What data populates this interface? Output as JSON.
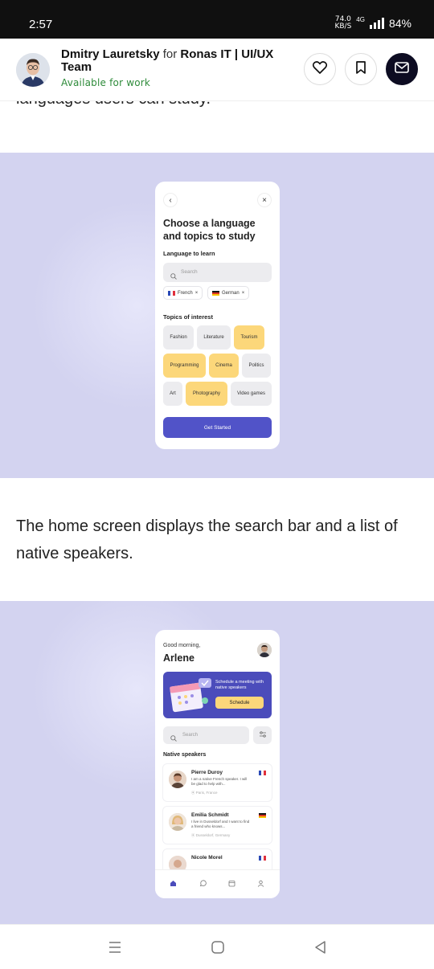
{
  "status_bar": {
    "time": "2:57",
    "speed_value": "74.0",
    "speed_unit": "KB/S",
    "network": "4G",
    "battery": "84%"
  },
  "header": {
    "author_name": "Dmitry Lauretsky",
    "for_text": "for",
    "team_name": "Ronas IT | UI/UX Team",
    "availability": "Available for work",
    "icons": [
      "heart-icon",
      "bookmark-icon",
      "mail-icon"
    ]
  },
  "article": {
    "cut_text": "languages users can study.",
    "paragraph": "The home screen displays the search bar and a list of native speakers."
  },
  "screen1": {
    "back": "‹",
    "close": "×",
    "title": "Choose a language and topics to study",
    "language_label": "Language to learn",
    "search_placeholder": "Search",
    "chips": [
      {
        "label": "French",
        "flag": "fr"
      },
      {
        "label": "German",
        "flag": "de"
      }
    ],
    "topics_label": "Topics of interest",
    "topics": [
      {
        "label": "Fashion",
        "selected": false
      },
      {
        "label": "Literature",
        "selected": false
      },
      {
        "label": "Tourism",
        "selected": true
      },
      {
        "label": "Programming",
        "selected": true
      },
      {
        "label": "Cinema",
        "selected": true
      },
      {
        "label": "Politics",
        "selected": false
      },
      {
        "label": "Art",
        "selected": false
      },
      {
        "label": "Photography",
        "selected": true
      },
      {
        "label": "Video games",
        "selected": false
      }
    ],
    "cta": "Get Started"
  },
  "screen2": {
    "greeting": "Good morning,",
    "name": "Arlene",
    "banner_text": "Schedule a meeting with native speakers",
    "banner_button": "Schedule",
    "search_placeholder": "Search",
    "section_title": "Native speakers",
    "speakers": [
      {
        "name": "Pierre Duroy",
        "bio": "I am a native French speaker. I will be glad to help with...",
        "location": "Paris, France",
        "flag": "fr"
      },
      {
        "name": "Emilia Schmidt",
        "bio": "I live in Dusseldorf and I want to find a friend who knows...",
        "location": "Dusseldorf, Germany",
        "flag": "de"
      },
      {
        "name": "Nicole Morel",
        "bio": "",
        "location": "",
        "flag": "fr"
      }
    ]
  },
  "colors": {
    "accent": "#5153c8",
    "highlight": "#fcd77a",
    "shot_background": "#d3d3f0",
    "available_green": "#2e8b3a"
  }
}
